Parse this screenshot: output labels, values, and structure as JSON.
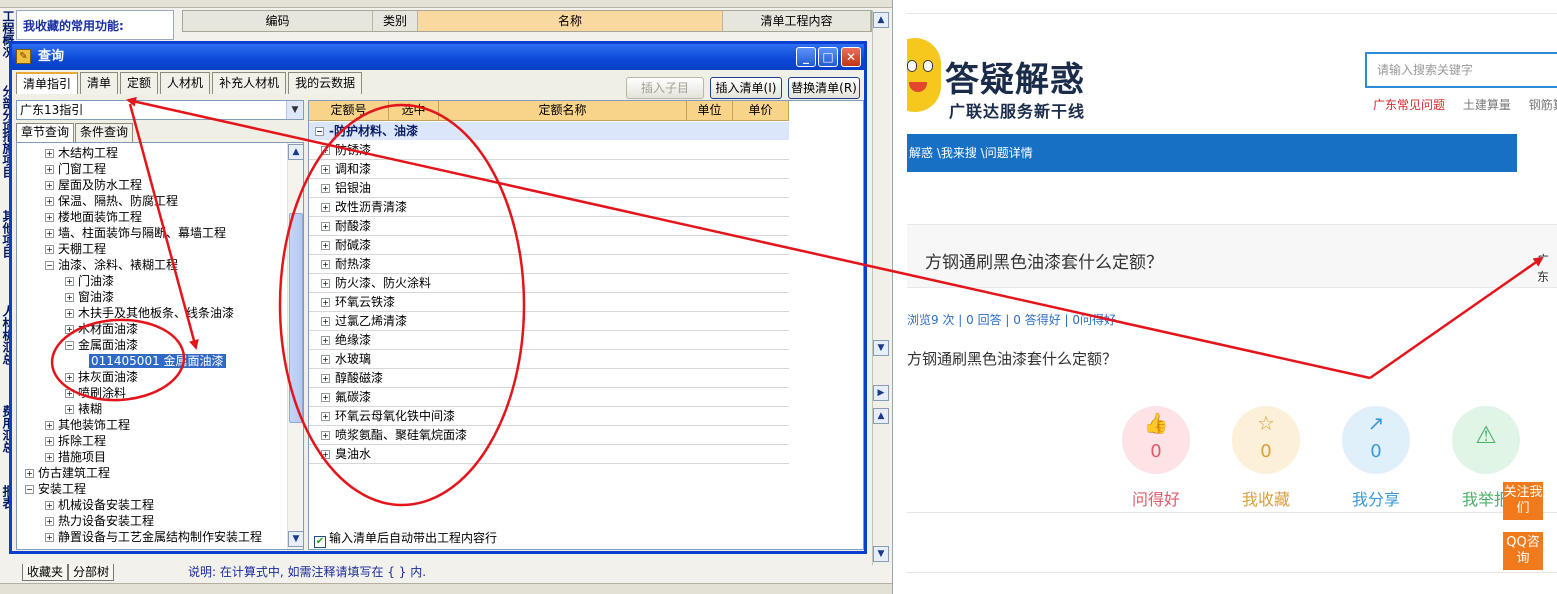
{
  "leftapp": {
    "side_labels": [
      "工程概况",
      "分部分项",
      "措施项目",
      "其他项目",
      "人材机汇总",
      "费用汇总",
      "报表"
    ],
    "favorites_label": "我收藏的常用功能:",
    "grid_headers": [
      "编码",
      "类别",
      "名称",
      "清单工程内容"
    ],
    "bottom_tabs": [
      "收藏夹",
      "分部树"
    ],
    "explain": "说明: 在计算式中, 如需注释请填写在 { } 内."
  },
  "dialog": {
    "title": "查询",
    "tabs": [
      "清单指引",
      "清单",
      "定额",
      "人材机",
      "补充人材机",
      "我的云数据"
    ],
    "buttons": {
      "insert_child": "插入子目",
      "insert_list": "插入清单(I)",
      "replace_list": "替换清单(R)"
    },
    "combo_value": "广东13指引",
    "subtabs": [
      "章节查询",
      "条件查询"
    ],
    "tree": [
      {
        "level": 1,
        "exp": "+",
        "text": "木结构工程"
      },
      {
        "level": 1,
        "exp": "+",
        "text": "门窗工程"
      },
      {
        "level": 1,
        "exp": "+",
        "text": "屋面及防水工程"
      },
      {
        "level": 1,
        "exp": "+",
        "text": "保温、隔热、防腐工程"
      },
      {
        "level": 1,
        "exp": "+",
        "text": "楼地面装饰工程"
      },
      {
        "level": 1,
        "exp": "+",
        "text": "墙、柱面装饰与隔断、幕墙工程"
      },
      {
        "level": 1,
        "exp": "+",
        "text": "天棚工程"
      },
      {
        "level": 1,
        "exp": "-",
        "text": "油漆、涂料、裱糊工程"
      },
      {
        "level": 2,
        "exp": "+",
        "text": "门油漆"
      },
      {
        "level": 2,
        "exp": "+",
        "text": "窗油漆"
      },
      {
        "level": 2,
        "exp": "+",
        "text": "木扶手及其他板条、线条油漆"
      },
      {
        "level": 2,
        "exp": "+",
        "text": "木材面油漆"
      },
      {
        "level": 2,
        "exp": "-",
        "text": "金属面油漆"
      },
      {
        "level": 3,
        "exp": "",
        "text": "011405001  金属面油漆",
        "selected": true
      },
      {
        "level": 2,
        "exp": "+",
        "text": "抹灰面油漆"
      },
      {
        "level": 2,
        "exp": "+",
        "text": "喷刷涂料"
      },
      {
        "level": 2,
        "exp": "+",
        "text": "裱糊"
      },
      {
        "level": 1,
        "exp": "+",
        "text": "其他装饰工程"
      },
      {
        "level": 1,
        "exp": "+",
        "text": "拆除工程"
      },
      {
        "level": 1,
        "exp": "+",
        "text": "措施项目"
      },
      {
        "level": 0,
        "exp": "+",
        "text": "仿古建筑工程"
      },
      {
        "level": 0,
        "exp": "-",
        "text": "安装工程"
      },
      {
        "level": 1,
        "exp": "+",
        "text": "机械设备安装工程"
      },
      {
        "level": 1,
        "exp": "+",
        "text": "热力设备安装工程"
      },
      {
        "level": 1,
        "exp": "+",
        "text": "静置设备与工艺金属结构制作安装工程"
      }
    ],
    "quota_headers": [
      "定额号",
      "选中",
      "定额名称",
      "单位",
      "单价"
    ],
    "quota_group": "-防护材料、油漆",
    "quota_rows": [
      "防锈漆",
      "调和漆",
      "铝银油",
      "改性沥青清漆",
      "耐酸漆",
      "耐碱漆",
      "耐热漆",
      "防火漆、防火涂料",
      "环氧云铁漆",
      "过氯乙烯清漆",
      "绝缘漆",
      "水玻璃",
      "醇酸磁漆",
      "氟碳漆",
      "环氧云母氧化铁中间漆",
      "喷浆氨酯、聚硅氧烷面漆",
      "臭油水"
    ],
    "auto_checkbox_label": "输入清单后自动带出工程内容行"
  },
  "webpage": {
    "brand_title": "答疑解惑",
    "brand_sub": "广联达服务新干线",
    "search_placeholder": "请输入搜索关键字",
    "quicklinks": [
      "广东常见问题",
      "土建算量",
      "钢筋算"
    ],
    "breadcrumb": "解惑 \\我来搜 \\问题详情",
    "question_title": "方钢通刷黑色油漆套什么定额？",
    "city_tag": "广东",
    "stats": "浏览9 次 | 0 回答 | 0 答得好 | 0问得好",
    "question_body": "方钢通刷黑色油漆套什么定额？",
    "actions": [
      {
        "label": "问得好",
        "count": "0",
        "icon": "thumbs-up-icon",
        "color": "#e05a6a",
        "bg": "#fde3e6"
      },
      {
        "label": "我收藏",
        "count": "0",
        "icon": "star-icon",
        "color": "#d9a03a",
        "bg": "#fdf0d8"
      },
      {
        "label": "我分享",
        "count": "0",
        "icon": "share-icon",
        "color": "#3a9ad9",
        "bg": "#dff0fb"
      },
      {
        "label": "我举报",
        "count": "",
        "icon": "warning-icon",
        "color": "#4caf6a",
        "bg": "#e0f5e6"
      }
    ],
    "side_buttons": [
      "关注我们",
      "QQ咨询"
    ]
  }
}
